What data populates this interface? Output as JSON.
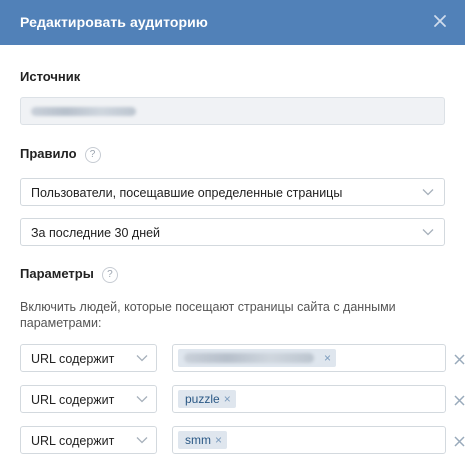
{
  "dialog": {
    "title": "Редактировать аудиторию",
    "close_icon": "close-icon",
    "header_color": "#5181b8"
  },
  "source": {
    "label": "Источник",
    "value_obscured": true
  },
  "rule": {
    "label": "Правило",
    "help": "?",
    "page_filter": "Пользователи, посещавшие определенные страницы",
    "period": "За последние 30 дней"
  },
  "parameters": {
    "label": "Параметры",
    "help": "?",
    "description": "Включить людей, которые посещают страницы сайта с данными параметрами:",
    "rows": [
      {
        "condition": "URL содержит",
        "tag": "",
        "tag_obscured": true,
        "remove": "×"
      },
      {
        "condition": "URL содержит",
        "tag": "puzzle",
        "tag_obscured": false,
        "remove": "×"
      },
      {
        "condition": "URL содержит",
        "tag": "smm",
        "tag_obscured": false,
        "remove": "×"
      }
    ]
  }
}
